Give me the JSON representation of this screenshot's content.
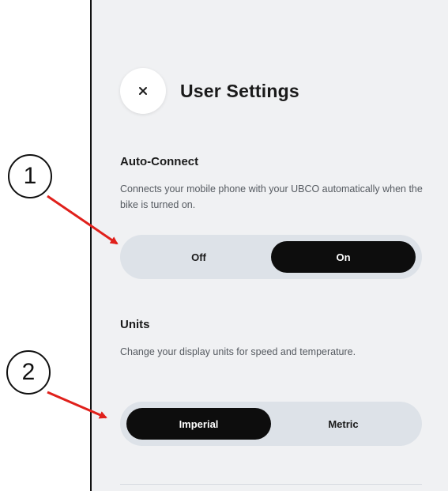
{
  "header": {
    "title": "User Settings",
    "close_icon": "close-icon"
  },
  "auto_connect": {
    "title": "Auto-Connect",
    "description": "Connects your mobile phone with your UBCO automatically when the bike is turned on.",
    "options": [
      {
        "label": "Off",
        "selected": false
      },
      {
        "label": "On",
        "selected": true
      }
    ]
  },
  "units": {
    "title": "Units",
    "description": "Change your display units for speed and temperature.",
    "options": [
      {
        "label": "Imperial",
        "selected": true
      },
      {
        "label": "Metric",
        "selected": false
      }
    ]
  },
  "annotations": {
    "callout_1": "1",
    "callout_2": "2",
    "arrow_color": "#e0201b"
  },
  "colors": {
    "panel_bg": "#f0f1f3",
    "toggle_bg": "#dde2e8",
    "active_bg": "#0d0d0d"
  }
}
